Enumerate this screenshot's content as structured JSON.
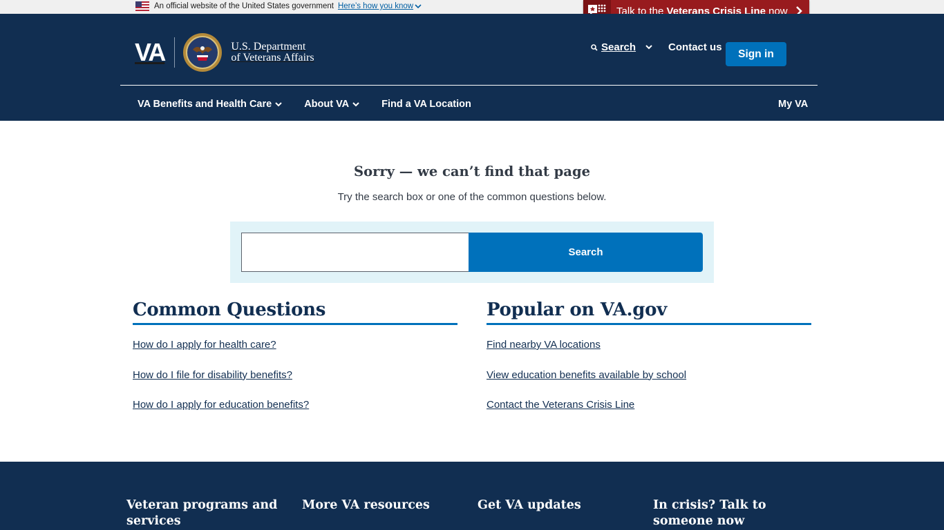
{
  "gov_banner": {
    "text": "An official website of the United States government",
    "link": "Here’s how you know"
  },
  "crisis_line": {
    "prefix": "Talk to the ",
    "bold": "Veterans Crisis Line",
    "suffix": " now"
  },
  "header": {
    "logo_mark": "VA",
    "dept_line1": "U.S. Department",
    "dept_line2": "of Veterans Affairs",
    "search_label": "Search",
    "contact_label": "Contact us",
    "signin_label": "Sign in"
  },
  "nav": {
    "items": [
      {
        "label": "VA Benefits and Health Care",
        "has_dropdown": true
      },
      {
        "label": "About VA",
        "has_dropdown": true
      },
      {
        "label": "Find a VA Location",
        "has_dropdown": false
      }
    ],
    "myva_label": "My VA"
  },
  "main": {
    "title": "Sorry — we can’t find that page",
    "subtitle": "Try the search box or one of the common questions below.",
    "search": {
      "value": "",
      "placeholder": "",
      "button_label": "Search"
    },
    "common_questions": {
      "heading": "Common Questions",
      "links": [
        "How do I apply for health care?",
        "How do I file for disability benefits?",
        "How do I apply for education benefits?"
      ]
    },
    "popular": {
      "heading": "Popular on VA.gov",
      "links": [
        "Find nearby VA locations",
        "View education benefits available by school",
        "Contact the Veterans Crisis Line"
      ]
    }
  },
  "footer": {
    "columns": [
      "Veteran programs and services",
      "More VA resources",
      "Get VA updates",
      "In crisis? Talk to someone now"
    ]
  },
  "colors": {
    "header_bg": "#112e51",
    "primary_blue": "#0071bb",
    "crisis_red": "#981b1e",
    "search_panel_bg": "#e1f3f8",
    "gov_banner_bg": "#f0f0f0"
  }
}
